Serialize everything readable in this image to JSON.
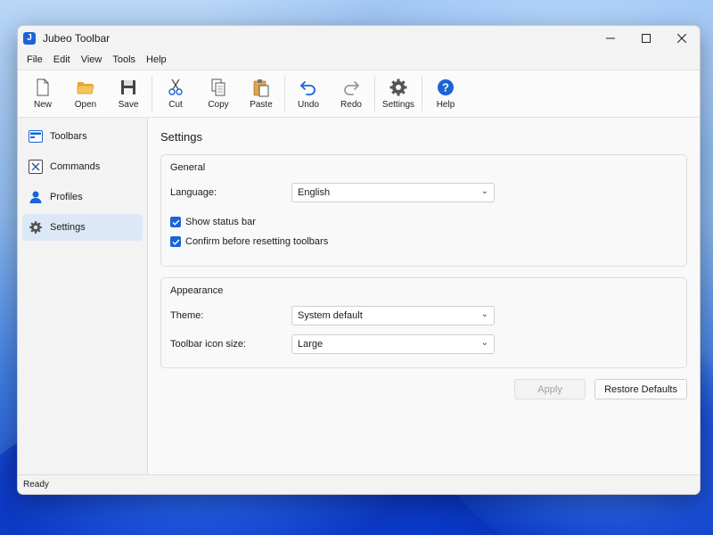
{
  "window": {
    "title": "Jubeo Toolbar",
    "app_icon_letter": "J"
  },
  "window_controls": {
    "minimize": "—",
    "maximize": "☐",
    "close": "✕"
  },
  "menu": [
    "File",
    "Edit",
    "View",
    "Tools",
    "Help"
  ],
  "toolbar": {
    "new": "New",
    "open": "Open",
    "save": "Save",
    "cut": "Cut",
    "copy": "Copy",
    "paste": "Paste",
    "undo": "Undo",
    "redo": "Redo",
    "settings": "Settings",
    "help": "Help"
  },
  "sidebar": {
    "items": [
      {
        "label": "Toolbars",
        "icon": "toolbars-icon"
      },
      {
        "label": "Commands",
        "icon": "commands-icon"
      },
      {
        "label": "Profiles",
        "icon": "profile-icon"
      },
      {
        "label": "Settings",
        "icon": "gear-icon",
        "active": true
      }
    ]
  },
  "page": {
    "title": "Settings"
  },
  "general": {
    "title": "General",
    "language_label": "Language:",
    "language_value": "English",
    "show_status_bar": "Show status bar",
    "show_status_bar_checked": true,
    "confirm_reset": "Confirm before resetting toolbars",
    "confirm_reset_checked": true
  },
  "appearance": {
    "title": "Appearance",
    "theme_label": "Theme:",
    "theme_value": "System default",
    "icon_size_label": "Toolbar icon size:",
    "icon_size_value": "Large"
  },
  "actions": {
    "apply": "Apply",
    "restore": "Restore Defaults"
  },
  "status": {
    "text": "Ready"
  },
  "colors": {
    "accent": "#1a64d8",
    "sidebar_active": "#dde8f6"
  }
}
